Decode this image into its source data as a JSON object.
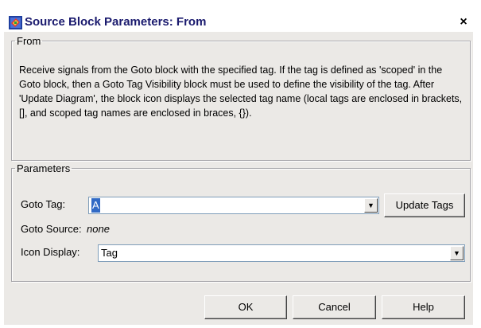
{
  "window": {
    "title": "Source Block Parameters: From",
    "close_glyph": "×",
    "icon": "simulink-block-icon"
  },
  "from_group": {
    "legend": "From",
    "description": "Receive signals from the Goto block with the specified tag.  If the tag is defined as 'scoped' in the Goto block, then a Goto Tag Visibility block must be used to define the visibility of the tag.  After 'Update Diagram', the block icon displays the selected tag name  (local tags are enclosed in brackets, [], and scoped tag names are enclosed in braces, {})."
  },
  "parameters_group": {
    "legend": "Parameters",
    "goto_tag": {
      "label": "Goto Tag:",
      "value": "A",
      "arrow_icon": "dropdown-arrow-icon"
    },
    "update_tags_label": "Update Tags",
    "goto_source": {
      "label": "Goto Source:",
      "value": "none"
    },
    "icon_display": {
      "label": "Icon Display:",
      "value": "Tag",
      "arrow_icon": "dropdown-arrow-icon"
    }
  },
  "footer": {
    "ok_label": "OK",
    "cancel_label": "Cancel",
    "help_label": "Help"
  },
  "colors": {
    "dialog_background": "#ebe9e6",
    "title_text": "#1a1a6e",
    "selection": "#316ac5"
  }
}
